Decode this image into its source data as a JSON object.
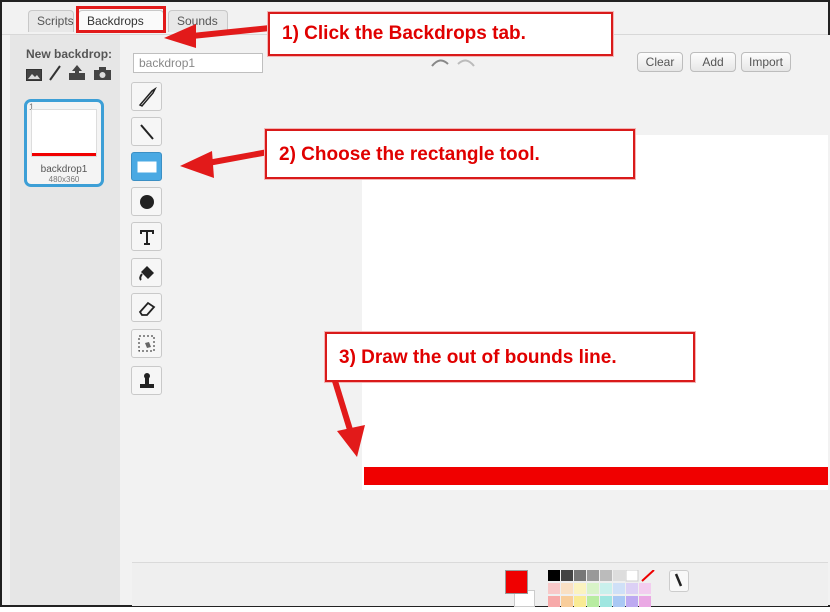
{
  "tabs": {
    "scripts": "Scripts",
    "backdrops": "Backdrops",
    "sounds": "Sounds"
  },
  "left_panel": {
    "title": "New backdrop:",
    "icons": [
      "paint-image-icon",
      "paint-brush-icon",
      "upload-icon",
      "camera-icon"
    ],
    "backdrop": {
      "index": "1",
      "name": "backdrop1",
      "size": "480x360"
    }
  },
  "editor": {
    "name_value": "backdrop1",
    "clear_label": "Clear",
    "add_label": "Add",
    "import_label": "Import",
    "tools": [
      "brush",
      "line",
      "rectangle",
      "ellipse",
      "text",
      "fill",
      "eraser",
      "select",
      "stamp"
    ],
    "selected_tool": "rectangle",
    "fill_color": "#f00000",
    "stroke_color": "#ffffff"
  },
  "annotations": {
    "step1": "1) Click the Backdrops tab.",
    "step2": "2) Choose the rectangle tool.",
    "step3": "3) Draw the out of bounds line.",
    "color": "#e00000"
  }
}
